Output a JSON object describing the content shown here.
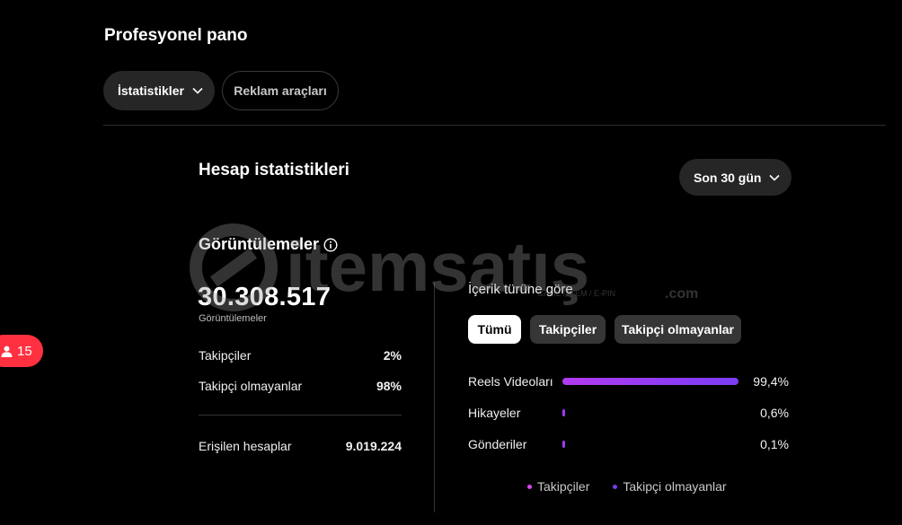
{
  "header": {
    "title": "Profesyonel pano",
    "tabs": [
      {
        "label": "İstatistikler",
        "icon": "chevron-down-icon"
      },
      {
        "label": "Reklam araçları"
      }
    ]
  },
  "account": {
    "title": "Hesap istatistikleri",
    "range": {
      "selected": "Son 30 gün",
      "icon": "chevron-down-icon"
    }
  },
  "views": {
    "title": "Görüntülemeler",
    "info_icon": "info-icon",
    "total": "30.308.517",
    "total_label": "Görüntülemeler",
    "followers": {
      "label": "Takipçiler",
      "value": "2%"
    },
    "non_followers": {
      "label": "Takipçi olmayanlar",
      "value": "98%"
    },
    "reached": {
      "label": "Erişilen hesaplar",
      "value": "9.019.224"
    }
  },
  "content_type": {
    "title": "İçerik türüne göre",
    "filters": [
      "Tümü",
      "Takipçiler",
      "Takipçi olmayanlar"
    ],
    "selected_filter": "Tümü",
    "rows": [
      {
        "label": "Reels Videoları",
        "pct": "99,4%",
        "value": 99.4
      },
      {
        "label": "Hikayeler",
        "pct": "0,6%",
        "value": 0.6
      },
      {
        "label": "Gönderiler",
        "pct": "0,1%",
        "value": 0.1
      }
    ],
    "legend": [
      {
        "label": "Takipçiler",
        "color": "#d946ef"
      },
      {
        "label": "Takipçi olmayanlar",
        "color": "#7c3aed"
      }
    ]
  },
  "notification": {
    "count": "15",
    "icon": "person-icon",
    "color": "#ff3040"
  },
  "watermark": {
    "text": "itemsatış",
    "subtext": "GAME / ITEM / E-PIN",
    "suffix": ".com"
  }
}
